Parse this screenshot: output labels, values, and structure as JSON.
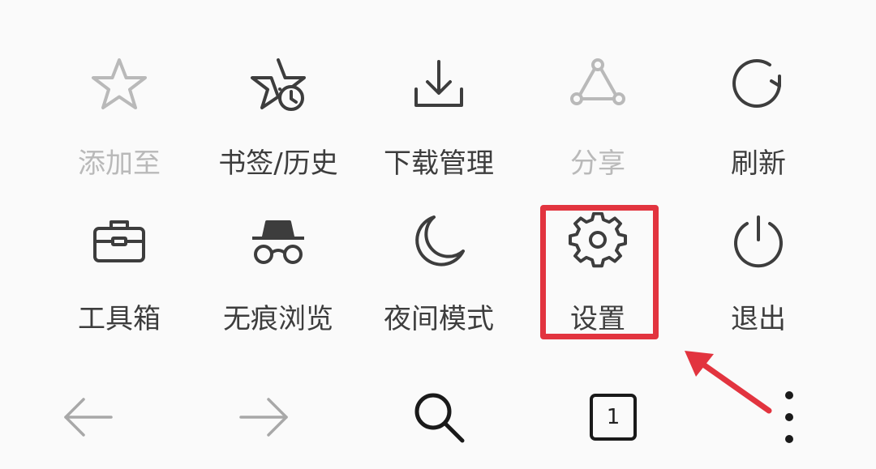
{
  "menu": {
    "row1": [
      {
        "label": "添加至",
        "icon": "star-icon",
        "enabled": false
      },
      {
        "label": "书签/历史",
        "icon": "bookmark-history-icon",
        "enabled": true
      },
      {
        "label": "下载管理",
        "icon": "download-icon",
        "enabled": true
      },
      {
        "label": "分享",
        "icon": "share-icon",
        "enabled": false
      },
      {
        "label": "刷新",
        "icon": "refresh-icon",
        "enabled": true
      }
    ],
    "row2": [
      {
        "label": "工具箱",
        "icon": "toolbox-icon",
        "enabled": true
      },
      {
        "label": "无痕浏览",
        "icon": "incognito-icon",
        "enabled": true
      },
      {
        "label": "夜间模式",
        "icon": "moon-icon",
        "enabled": true
      },
      {
        "label": "设置",
        "icon": "gear-icon",
        "enabled": true,
        "highlighted": true
      },
      {
        "label": "退出",
        "icon": "power-icon",
        "enabled": true
      }
    ]
  },
  "bottom_bar": {
    "back": {
      "icon": "arrow-left-icon",
      "enabled": false
    },
    "forward": {
      "icon": "arrow-right-icon",
      "enabled": false
    },
    "search": {
      "icon": "search-icon"
    },
    "tabs": {
      "icon": "tabs-icon",
      "count": "1"
    },
    "more": {
      "icon": "more-vertical-icon"
    }
  },
  "colors": {
    "background": "#fafafa",
    "text_enabled": "#3d3d3d",
    "text_disabled": "#b9b9b9",
    "highlight": "#e2343f"
  }
}
